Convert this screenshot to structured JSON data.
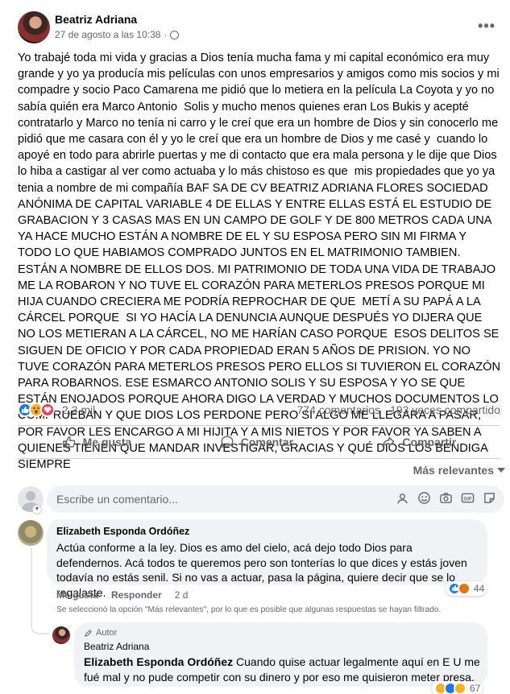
{
  "post": {
    "author": "Beatriz Adriana",
    "timestamp": "27 de agosto a las 10:38",
    "separator": "·",
    "more": "•••",
    "body": "Yo trabajé toda mi vida y gracias a Dios tenía mucha fama y mi capital económico era muy grande y yo ya producía mis películas con unos empresarios y amigos como mis socios y mi compadre y socio Paco Camarena me pidió que lo metiera en la película La Coyota y yo no sabía quién era Marco Antonio  Solis y mucho menos quienes eran Los Bukis y acepté contratarlo y Marco no tenía ni carro y le creí que era un hombre de Dios y sin conocerlo me pidió que me casara con él y yo le creí que era un hombre de Dios y me casé y  cuando lo apoyé en todo para abrirle puertas y me di contacto que era mala persona y le dije que Dios lo hiba a castigar al ver como actuaba y lo más chistoso es que  mis propiedades que yo ya tenia a nombre de mi compañía BAF SA DE CV BEATRIZ ADRIANA FLORES SOCIEDAD ANÓNIMA DE CAPITAL VARIABLE 4 DE ELLAS Y ENTRE ELLAS ESTÁ EL ESTUDIO DE GRABACION Y 3 CASAS MAS EN UN CAMPO DE GOLF Y DE 800 METROS CADA UNA YA HACE MUCHO ESTÁN A NOMBRE DE EL Y SU ESPOSA PERO SIN MI FIRMA Y TODO LO QUE HABIAMOS COMPRADO JUNTOS EN EL MATRIMONIO TAMBIEN. ESTÁN A NOMBRE DE ELLOS DOS. MI PATRIMONIO DE TODA UNA VIDA DE TRABAJO ME LA ROBARON Y NO TUVE EL CORAZÓN PARA METERLOS PRESOS PORQUE MI HIJA CUANDO CRECIERA ME PODRÍA REPROCHAR DE QUE  METÍ A SU PAPÁ A LA CÁRCEL PORQUE  SI YO HACÍA LA DENUNCIA AUNQUE DESPUÉS YO DIJERA QUE NO LOS METIERAN A LA CÁRCEL, NO ME HARÍAN CASO PORQUE  ESOS DELITOS SE SIGUEN DE OFICIO Y POR CADA PROPIEDAD ERAN 5 AÑOS DE PRISION. YO NO TUVE CORAZÓN PARA METERLOS PRESOS PERO ELLOS SI TUVIERON EL CORAZÓN PARA ROBARNOS. ESE ESMARCO ANTONIO SOLIS Y SU ESPOSA Y YO SE QUE ESTÁN ENOJADOS PORQUE AHORA DIGO LA VERDAD Y MUCHOS DOCUMENTOS LO COMPRUEBAN Y QUE DIOS LOS PERDONE PERO SI ALGO ME LLEGARA A PASAR, POR FAVOR LES ENCARGO A MI HIJITA Y A MIS NIETOS Y POR FAVOR YA SABEN A QUIENES TIENEN QUE MANDAR INVESTIGAR, GRACIAS Y QUÉ DIOS LOS BENDIGA SIEMPRE",
    "reaction_count": "2,3 mil",
    "comment_count": "774 comentarios",
    "share_count": "193 veces compartido"
  },
  "actions": {
    "like": "Me gusta",
    "comment": "Comentar",
    "share": "Compartir"
  },
  "sort": {
    "label": "Más relevantes"
  },
  "compose": {
    "placeholder": "Escribe un comentario..."
  },
  "comments": [
    {
      "author": "Elizabeth Esponda Ordóñez",
      "text": "Actúa conforme a la ley. Dios es amo del cielo, acá dejo todo Dios para defendernos. Acá todos te queremos pero son tonterías lo que dices y estás joven todavía no estás senil. Si no vas a actuar, pasa la página, quiere decir que se lo regalaste.",
      "like": "Me gusta",
      "reply": "Responder",
      "time": "2 d",
      "reaction_count": "44"
    }
  ],
  "filter_note": "Se seleccionó la opción \"Más relevantes\", por lo que es posible que algunas respuestas se hayan filtrado.",
  "reply": {
    "badge": "Autor",
    "author": "Beatriz Adriana",
    "mention": "Elizabeth Esponda Ordóñez",
    "text": " Cuando quise actuar legalmente aquí en E U me fué mal y no pude competir con su dinero y por eso me quisieron meter presa.",
    "reaction_count": "67"
  },
  "colors": {
    "accent": "#1877f2",
    "secondary_text": "#65676b",
    "bubble": "#f0f2f5"
  }
}
